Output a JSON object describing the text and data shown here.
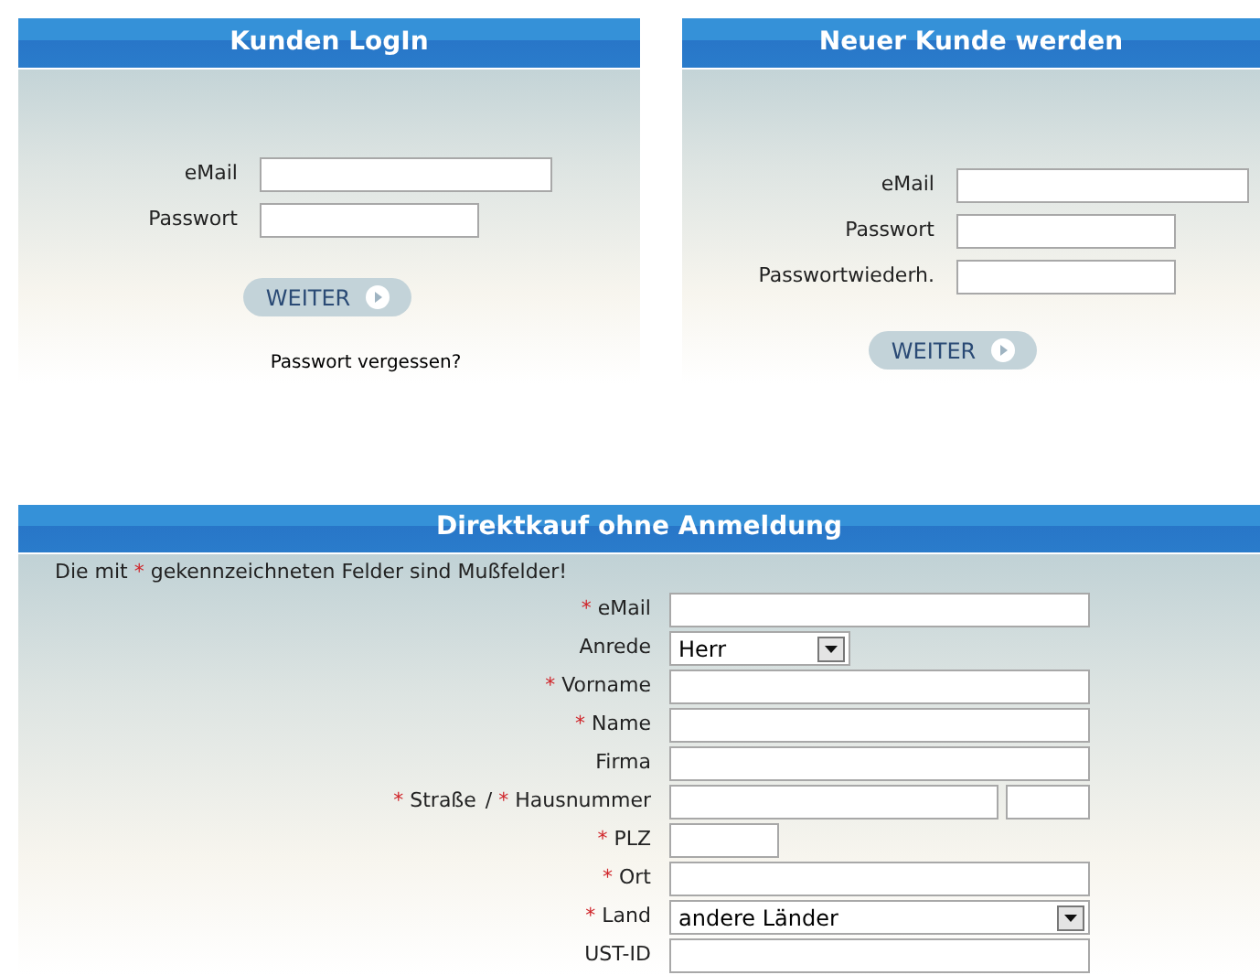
{
  "login": {
    "title": "Kunden LogIn",
    "fields": [
      {
        "label": "eMail",
        "kind": "long"
      },
      {
        "label": "Passwort",
        "kind": "medium"
      }
    ],
    "button": "WEITER",
    "link": "Passwort vergessen?"
  },
  "register": {
    "title": "Neuer Kunde werden",
    "fields": [
      {
        "label": "eMail",
        "kind": "long"
      },
      {
        "label": "Passwort",
        "kind": "medium"
      },
      {
        "label": "Passwortwiederh.",
        "kind": "medium"
      }
    ],
    "button": "WEITER"
  },
  "direct": {
    "title": "Direktkauf ohne Anmeldung",
    "note": {
      "before": "Die mit",
      "mark": "*",
      "after": "gekennzeichneten Felder sind Mußfelder!"
    },
    "rows": [
      {
        "kind": "text",
        "marker": "*",
        "label": "eMail"
      },
      {
        "kind": "select",
        "label": "Anrede",
        "value": "Herr"
      },
      {
        "kind": "text",
        "marker": "*",
        "label": "Vorname"
      },
      {
        "kind": "text",
        "marker": "*",
        "label": "Name"
      },
      {
        "kind": "text",
        "label": "Firma"
      },
      {
        "kind": "split",
        "parts": [
          {
            "marker": "*",
            "label": "Straße"
          },
          {
            "separator": "/",
            "marker": "*",
            "label": "Hausnummer"
          }
        ]
      },
      {
        "kind": "short",
        "marker": "*",
        "label": "PLZ"
      },
      {
        "kind": "text",
        "marker": "*",
        "label": "Ort"
      },
      {
        "kind": "wideselect",
        "marker": "*",
        "label": "Land",
        "value": "andere Länder"
      },
      {
        "kind": "text",
        "label": "UST-ID"
      }
    ]
  }
}
